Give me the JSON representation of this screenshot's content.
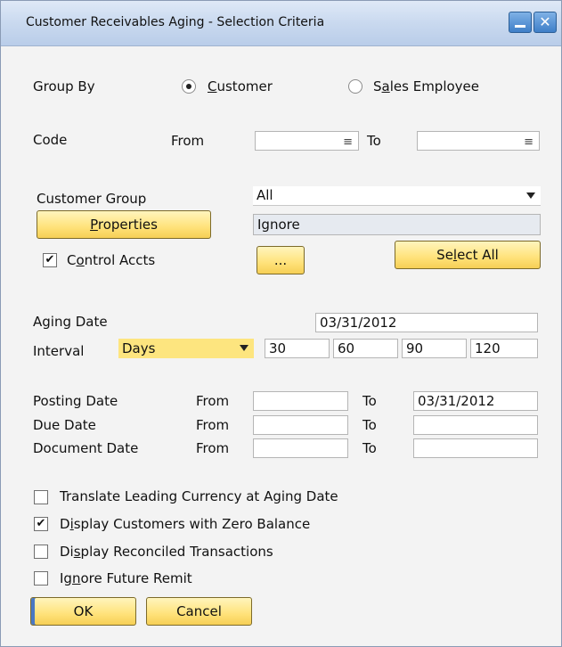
{
  "window": {
    "title": "Customer Receivables Aging - Selection Criteria"
  },
  "group_by": {
    "label": "Group By",
    "options": [
      {
        "label_pre": "",
        "label_u": "C",
        "label_post": "ustomer",
        "selected": true
      },
      {
        "label_pre": "S",
        "label_u": "a",
        "label_post": "les Employee",
        "selected": false
      }
    ]
  },
  "code": {
    "label": "Code",
    "from_label": "From",
    "to_label": "To",
    "from_value": "",
    "to_value": ""
  },
  "customer_group": {
    "label": "Customer Group",
    "value": "All"
  },
  "properties": {
    "button_u": "P",
    "button_rest": "roperties",
    "value": "Ignore"
  },
  "control_accts": {
    "label_pre": "C",
    "label_u": "o",
    "label_post": "ntrol Accts",
    "checked": true
  },
  "ellipsis_button": "...",
  "select_all": {
    "pre": "Se",
    "u": "l",
    "post": "ect All"
  },
  "aging_date": {
    "label": "Aging Date",
    "value": "03/31/2012"
  },
  "interval": {
    "label": "Interval",
    "unit": "Days",
    "values": [
      "30",
      "60",
      "90",
      "120"
    ]
  },
  "dates": {
    "from_label": "From",
    "to_label": "To",
    "rows": [
      {
        "label": "Posting Date",
        "from": "",
        "to": "03/31/2012"
      },
      {
        "label": "Due Date",
        "from": "",
        "to": ""
      },
      {
        "label": "Document Date",
        "from": "",
        "to": ""
      }
    ]
  },
  "options": [
    {
      "pre": "Translate Leading Currency at Aging Date",
      "u": "",
      "post": "",
      "checked": false
    },
    {
      "pre": "D",
      "u": "i",
      "post": "splay Customers with Zero Balance",
      "checked": true
    },
    {
      "pre": "Di",
      "u": "s",
      "post": "play Reconciled Transactions",
      "checked": false
    },
    {
      "pre": "Ig",
      "u": "n",
      "post": "ore Future Remit",
      "checked": false
    }
  ],
  "buttons": {
    "ok": "OK",
    "cancel": "Cancel"
  },
  "icons": {
    "minimize": "minimize-icon",
    "close": "close-icon",
    "list": "list-icon",
    "dropdown": "chevron-down-icon"
  },
  "colors": {
    "button_yellow": "#ffe27a",
    "title_bar": "#c9d9ef",
    "close_glyph": "✕",
    "check_glyph": "✔",
    "list_glyph": "≡"
  }
}
